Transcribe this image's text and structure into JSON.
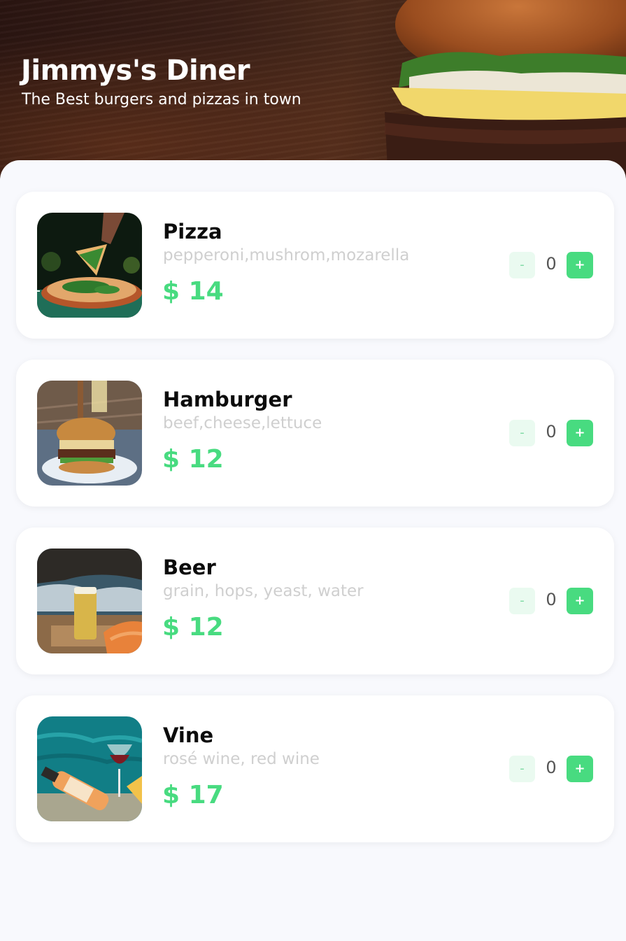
{
  "header": {
    "title": "Jimmys's Diner",
    "subtitle": "The Best burgers and pizzas in town"
  },
  "menu": {
    "items": [
      {
        "name": "Pizza",
        "ingredients": "pepperoni,mushrom,mozarella",
        "price": "$ 14",
        "quantity": "0",
        "image_icon": "pizza-photo"
      },
      {
        "name": "Hamburger",
        "ingredients": "beef,cheese,lettuce",
        "price": "$ 12",
        "quantity": "0",
        "image_icon": "hamburger-photo"
      },
      {
        "name": "Beer",
        "ingredients": "grain, hops, yeast, water",
        "price": "$ 12",
        "quantity": "0",
        "image_icon": "beer-photo"
      },
      {
        "name": "Vine",
        "ingredients": "rosé wine, red wine",
        "price": "$ 17",
        "quantity": "0",
        "image_icon": "wine-photo"
      }
    ],
    "decrement_label": "-",
    "increment_label": "+"
  },
  "colors": {
    "accent": "#48db80",
    "accent_light": "#eafaf0",
    "background": "#f8f9fd",
    "muted_text": "#cfcfcf"
  }
}
